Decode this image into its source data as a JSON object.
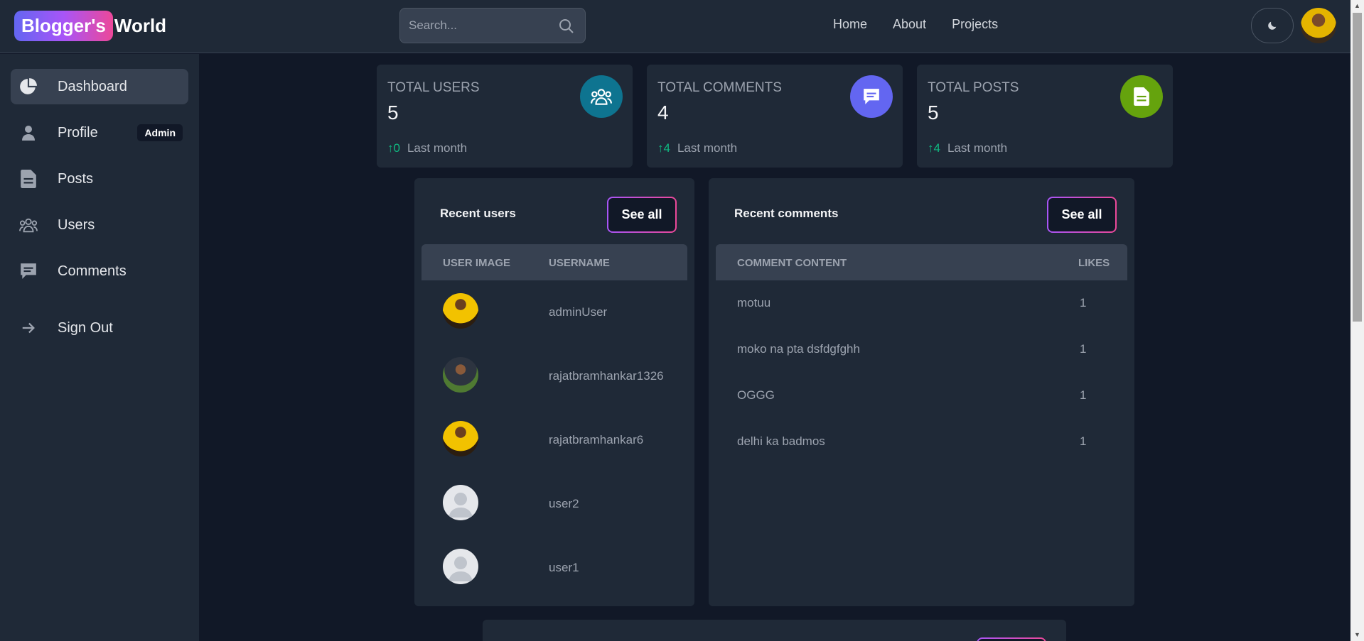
{
  "header": {
    "logo_highlight": "Blogger's",
    "logo_word": "World",
    "search_placeholder": "Search...",
    "nav": [
      "Home",
      "About",
      "Projects"
    ]
  },
  "sidebar": {
    "items": [
      {
        "label": "Dashboard",
        "icon": "pie-chart-icon",
        "active": true
      },
      {
        "label": "Profile",
        "icon": "user-icon",
        "badge": "Admin"
      },
      {
        "label": "Posts",
        "icon": "document-icon"
      },
      {
        "label": "Users",
        "icon": "users-icon"
      },
      {
        "label": "Comments",
        "icon": "comment-icon"
      },
      {
        "label": "Sign Out",
        "icon": "arrow-right-icon"
      }
    ]
  },
  "stats": [
    {
      "title": "Total Users",
      "value": "5",
      "change": "0",
      "period": "Last month",
      "color": "#0e7490",
      "icon": "users-icon"
    },
    {
      "title": "Total Comments",
      "value": "4",
      "change": "4",
      "period": "Last month",
      "color": "#6366f1",
      "icon": "comment-icon"
    },
    {
      "title": "Total Posts",
      "value": "5",
      "change": "4",
      "period": "Last month",
      "color": "#65a30d",
      "icon": "document-icon"
    }
  ],
  "recent_users": {
    "title": "Recent users",
    "see_all": "See all",
    "columns": [
      "User image",
      "Username"
    ],
    "rows": [
      {
        "username": "adminUser"
      },
      {
        "username": "rajatbramhankar1326"
      },
      {
        "username": "rajatbramhankar6"
      },
      {
        "username": "user2"
      },
      {
        "username": "user1"
      }
    ]
  },
  "recent_comments": {
    "title": "Recent comments",
    "see_all": "See all",
    "columns": [
      "Comment content",
      "Likes"
    ],
    "rows": [
      {
        "content": "motuu",
        "likes": "1"
      },
      {
        "content": "moko na pta dsfdgfghh",
        "likes": "1"
      },
      {
        "content": "OGGG",
        "likes": "1"
      },
      {
        "content": "delhi ka badmos",
        "likes": "1"
      }
    ]
  }
}
